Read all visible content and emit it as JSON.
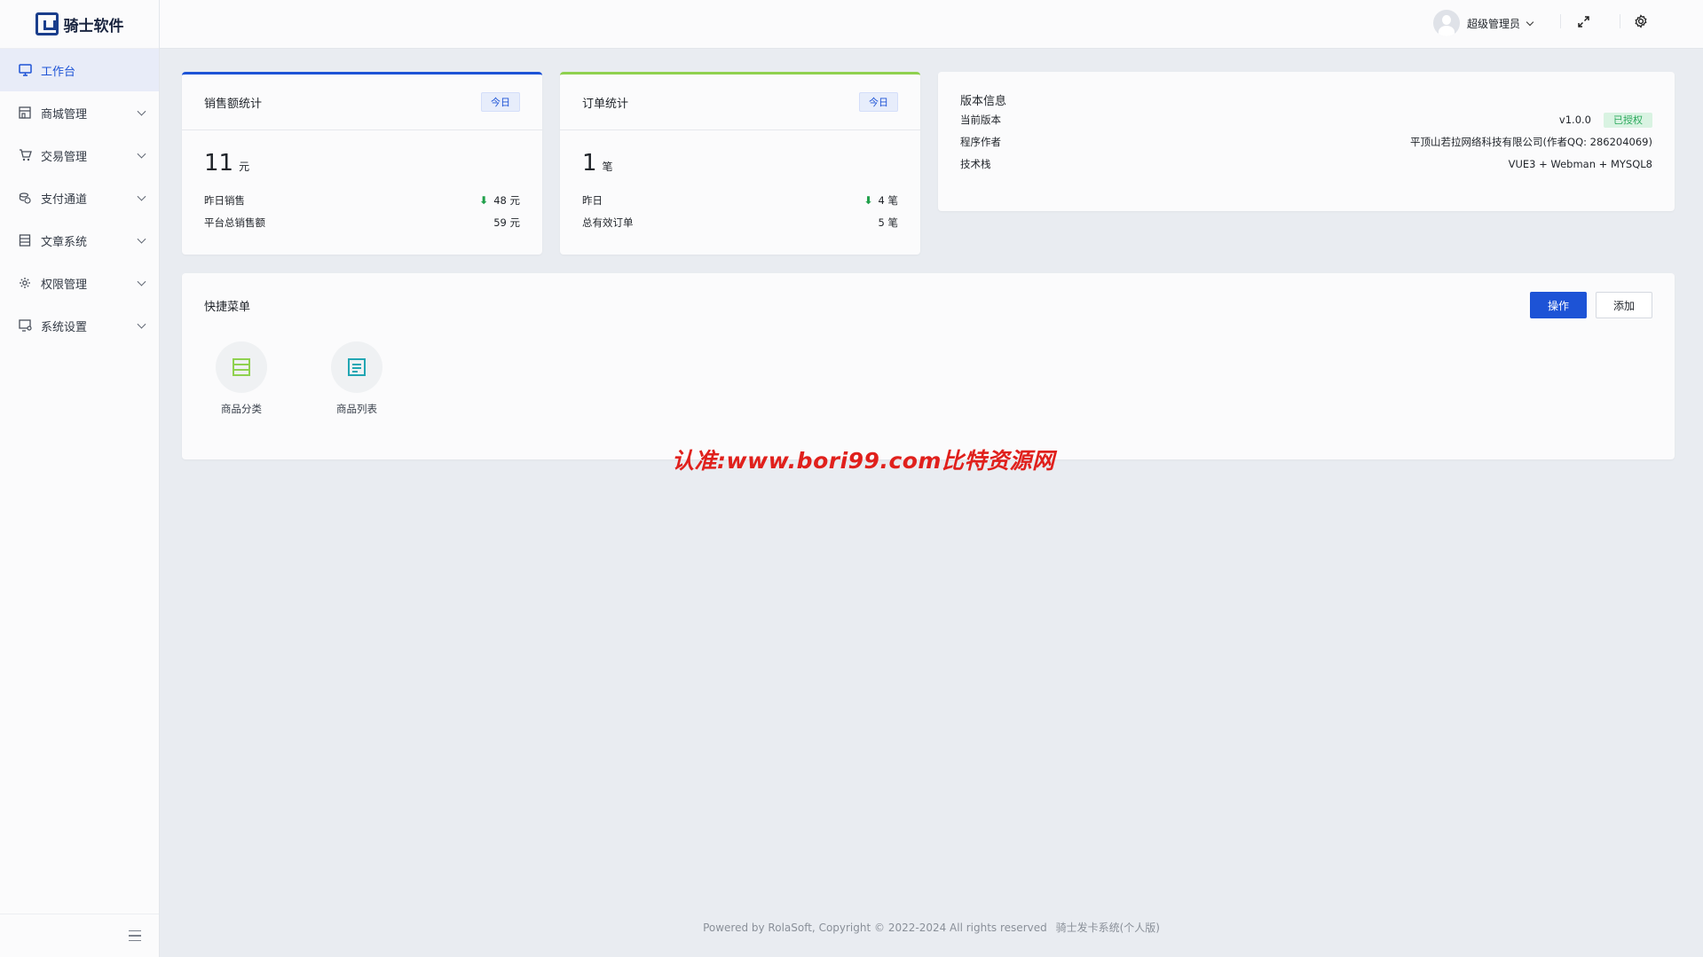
{
  "brand": {
    "name": "骑士软件",
    "accent": "#1d53d6"
  },
  "sidebar": {
    "items": [
      {
        "label": "工作台",
        "icon": "monitor-icon",
        "active": true
      },
      {
        "label": "商城管理",
        "icon": "store-icon"
      },
      {
        "label": "交易管理",
        "icon": "cart-icon"
      },
      {
        "label": "支付通道",
        "icon": "coins-icon"
      },
      {
        "label": "文章系统",
        "icon": "article-icon"
      },
      {
        "label": "权限管理",
        "icon": "gear-icon"
      },
      {
        "label": "系统设置",
        "icon": "settings-monitor-icon"
      }
    ]
  },
  "header": {
    "user_name": "超级管理员"
  },
  "sales": {
    "title": "销售额统计",
    "tag": "今日",
    "value": "11",
    "unit": "元",
    "rows": [
      {
        "label": "昨日销售",
        "value": "48 元"
      },
      {
        "label": "平台总销售额",
        "value": "59 元"
      }
    ]
  },
  "orders": {
    "title": "订单统计",
    "tag": "今日",
    "value": "1",
    "unit": "笔",
    "rows": [
      {
        "label": "昨日",
        "value": "4 笔"
      },
      {
        "label": "总有效订单",
        "value": "5 笔"
      }
    ]
  },
  "version": {
    "title": "版本信息",
    "current_label": "当前版本",
    "current_value": "v1.0.0",
    "license_badge": "已授权",
    "author_label": "程序作者",
    "author_value": "平顶山若拉网络科技有限公司(作者QQ: 286204069)",
    "stack_label": "技术栈",
    "stack_value": "VUE3 + Webman + MYSQL8"
  },
  "quick_menu": {
    "title": "快捷菜单",
    "action_label": "操作",
    "add_label": "添加",
    "items": [
      {
        "label": "商品分类",
        "icon": "category-icon",
        "color": "#8fd14f"
      },
      {
        "label": "商品列表",
        "icon": "list-icon",
        "color": "#22a6b3"
      }
    ]
  },
  "watermark": "认准:www.bori99.com比特资源网",
  "footer": {
    "copyright": "Powered by RolaSoft, Copyright © 2022-2024 All rights reserved",
    "edition": "骑士发卡系统(个人版)"
  }
}
